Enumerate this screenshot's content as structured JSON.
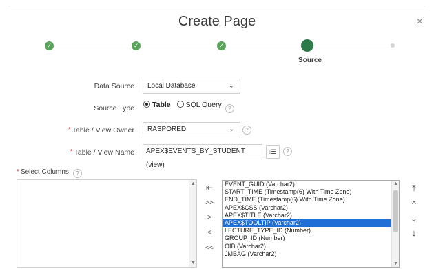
{
  "dialog": {
    "title": "Create Page",
    "close_glyph": "×"
  },
  "wizard": {
    "current_label": "Source",
    "done_glyph": "✓",
    "steps_completed": 3
  },
  "form": {
    "data_source": {
      "label": "Data Source",
      "value": "Local Database"
    },
    "source_type": {
      "label": "Source Type",
      "options": [
        "Table",
        "SQL Query"
      ],
      "selected": "Table"
    },
    "owner": {
      "label": "Table / View Owner",
      "value": "RASPORED"
    },
    "table_name": {
      "label": "Table / View Name",
      "value": "APEX$EVENTS_BY_STUDENT (view)",
      "list_glyph": "⁝☰"
    },
    "select_columns": {
      "label": "Select Columns"
    },
    "required_mark": "*",
    "help_glyph": "?"
  },
  "shuttle": {
    "controls": [
      "⇤",
      ">>",
      ">",
      "<",
      "<<"
    ],
    "order_controls": [
      "⤒",
      "^",
      "⌄",
      "⤓"
    ],
    "selected_columns": [
      "EVENT_GUID (Varchar2)",
      "START_TIME (Timestamp(6) With Time Zone)",
      "END_TIME (Timestamp(6) With Time Zone)",
      "APEX$CSS (Varchar2)",
      "APEX$TITLE (Varchar2)",
      "APEX$TOOLTIP (Varchar2)",
      "LECTURE_TYPE_ID (Number)",
      "GROUP_ID (Number)",
      "OIB (Varchar2)",
      "JMBAG (Varchar2)"
    ],
    "highlighted": "APEX$TOOLTIP (Varchar2)"
  },
  "colors": {
    "completed_step": "#5aa35a",
    "current_step": "#2c7a48",
    "selection": "#1f6fd6",
    "required": "#d32f2f"
  }
}
